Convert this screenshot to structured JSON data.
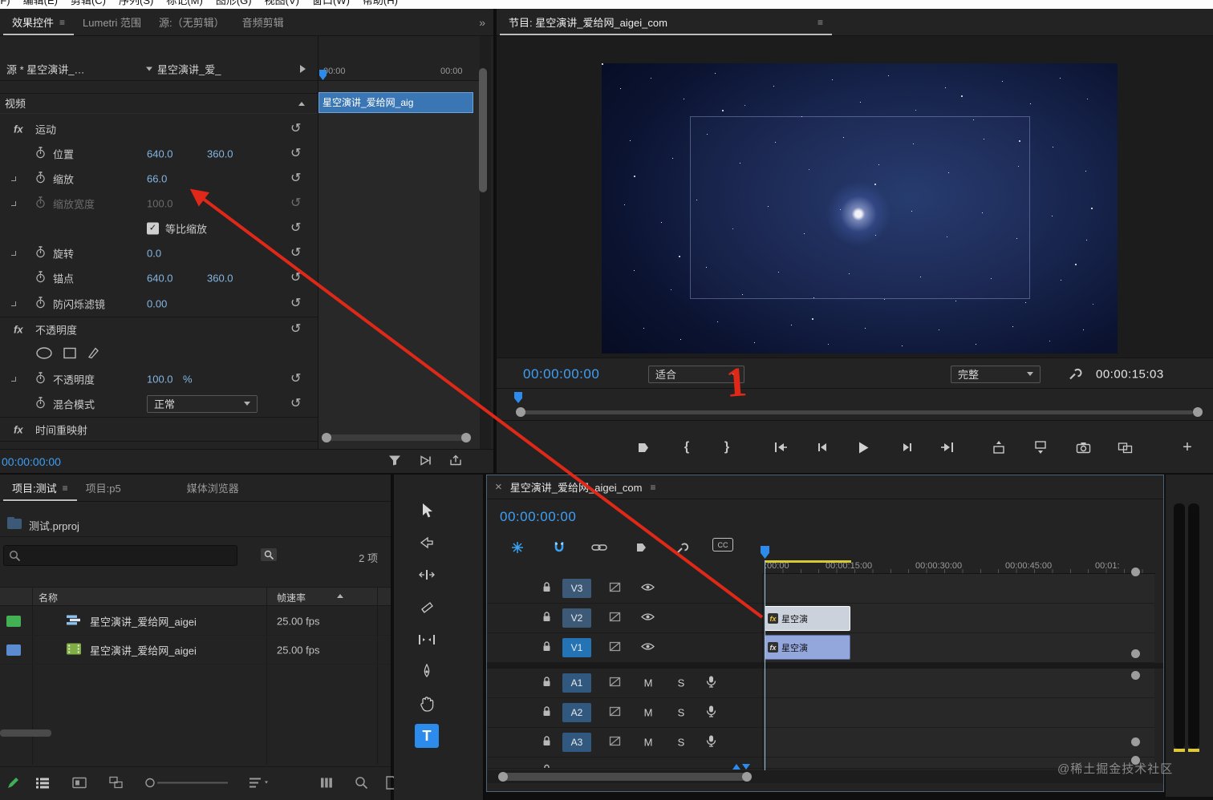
{
  "menubar": {
    "items": [
      "文件(F)",
      "编辑(E)",
      "剪辑(C)",
      "序列(S)",
      "标记(M)",
      "图形(G)",
      "视图(V)",
      "窗口(W)",
      "帮助(H)"
    ]
  },
  "glyphs": {
    "hamburger": "≡",
    "overflow": "»",
    "close": "×",
    "plus": "+",
    "in_brace": "{",
    "out_brace": "}",
    "fx": "fx",
    "reset": "↺",
    "check": "✓",
    "cc": "CC",
    "type_tool": "T"
  },
  "effect_controls": {
    "tabs": [
      "效果控件",
      "Lumetri 范围",
      "源:（无剪辑）",
      "音频剪辑"
    ],
    "source_label": "源 * 星空演讲_…",
    "clip_selector": "星空演讲_爱_",
    "video_section": "视频",
    "motion_group": "运动",
    "position_label": "位置",
    "position_x": "640.0",
    "position_y": "360.0",
    "scale_label": "缩放",
    "scale_value": "66.0",
    "scale_width_label": "缩放宽度",
    "scale_width_value": "100.0",
    "uniform_scale_label": "等比缩放",
    "rotation_label": "旋转",
    "rotation_value": "0.0",
    "anchor_label": "锚点",
    "anchor_x": "640.0",
    "anchor_y": "360.0",
    "antiflicker_label": "防闪烁滤镜",
    "antiflicker_value": "0.00",
    "opacity_group": "不透明度",
    "opacity_label": "不透明度",
    "opacity_value": "100.0",
    "opacity_unit": "%",
    "blend_label": "混合模式",
    "blend_value": "正常",
    "time_remap_group": "时间重映射",
    "timecode": "00:00:00:00",
    "mini_ruler_start": "00:00",
    "mini_ruler_end": "00:00",
    "mini_clip_label": "星空演讲_爱给网_aig"
  },
  "program_monitor": {
    "tab_label": "节目: 星空演讲_爱给网_aigei_com",
    "timecode": "00:00:00:00",
    "zoom_select": "适合",
    "resolution_select": "完整",
    "duration": "00:00:15:03"
  },
  "annotation": {
    "step_number": "1"
  },
  "project_panel": {
    "tabs": [
      "项目:测试",
      "项目:p5",
      "媒体浏览器"
    ],
    "breadcrumb": "测试.prproj",
    "item_count": "2 项",
    "col_name": "名称",
    "col_framerate": "帧速率",
    "items": [
      {
        "name": "星空演讲_爱给网_aigei",
        "framerate": "25.00 fps"
      },
      {
        "name": "星空演讲_爱给网_aigei",
        "framerate": "25.00 fps"
      }
    ]
  },
  "timeline": {
    "tab_label": "星空演讲_爱给网_aigei_com",
    "timecode": "00:00:00:00",
    "ruler_labels": [
      ":00:00",
      "00:00:15:00",
      "00:00:30:00",
      "00:00:45:00",
      "00:01:"
    ],
    "video_tracks": [
      "V3",
      "V2",
      "V1"
    ],
    "audio_tracks": [
      "A1",
      "A2",
      "A3"
    ],
    "mute": "M",
    "solo": "S",
    "clips": [
      {
        "label": "星空演"
      },
      {
        "label": "星空演"
      }
    ]
  },
  "watermark": "@稀土掘金技术社区"
}
